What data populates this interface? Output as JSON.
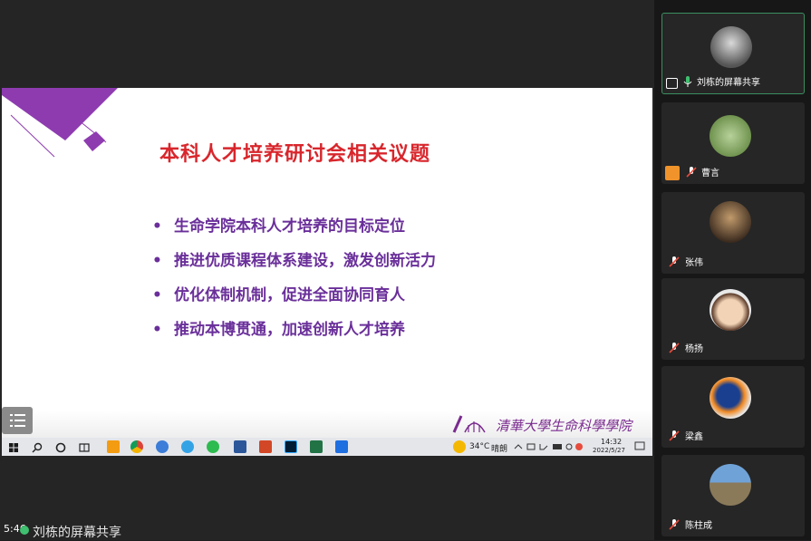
{
  "slide": {
    "title": "本科人才培养研讨会相关议题",
    "bullet_symbol": "•",
    "bullets": [
      "生命学院本科人才培养的目标定位",
      "推进优质课程体系建设，激发创新活力",
      "优化体制机制，促进全面协同育人",
      "推动本博贯通，加速创新人才培养"
    ],
    "footer_logo_text": "清華大學生命科學學院",
    "colors": {
      "title": "#d8262c",
      "bullets": "#6a2f9a",
      "deco": "#8e3bb0"
    }
  },
  "taskbar": {
    "weather": "34°C",
    "weather_desc": "晴朗",
    "time": "14:32",
    "date": "2022/5/27",
    "apps": [
      "start-icon",
      "search-icon",
      "cortana-icon",
      "taskview-icon",
      "app-orange-icon",
      "chrome-icon",
      "app-swirl-icon",
      "app-browser-icon",
      "wechat-icon",
      "word-icon",
      "powerpoint-icon",
      "photoshop-icon",
      "excel-icon",
      "app-meeting-icon"
    ]
  },
  "meeting": {
    "timer": "5:46",
    "share_label": "刘栋的屏幕共享",
    "participants": [
      {
        "name": "刘栋的屏幕共享",
        "status": "sharing",
        "mic": "on"
      },
      {
        "name": "曹言",
        "status": "host",
        "mic": "muted"
      },
      {
        "name": "张伟",
        "status": "",
        "mic": "muted"
      },
      {
        "name": "杨扬",
        "status": "",
        "mic": "muted"
      },
      {
        "name": "梁鑫",
        "status": "",
        "mic": "muted"
      },
      {
        "name": "陈柱成",
        "status": "",
        "mic": "muted"
      }
    ]
  }
}
